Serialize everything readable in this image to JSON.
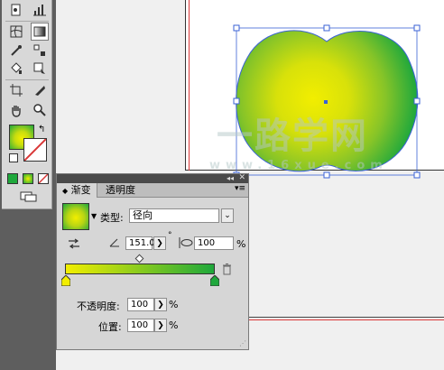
{
  "gradient_panel": {
    "tab_gradient": "渐变",
    "tab_transparency": "透明度",
    "type_label": "类型:",
    "type_value": "径向",
    "angle_value": "151.0",
    "degree_symbol": "°",
    "aspect_value": "100",
    "percent": "%",
    "opacity_label": "不透明度:",
    "opacity_value": "100",
    "location_label": "位置:",
    "location_value": "100",
    "colors": {
      "start": "#f2ee00",
      "end": "#1fa83c"
    }
  },
  "watermark": {
    "text": "一路学网",
    "url": "www.16xue.com"
  },
  "colors": {
    "accent_red": "#d93838",
    "selection_blue": "#3a62d6"
  }
}
